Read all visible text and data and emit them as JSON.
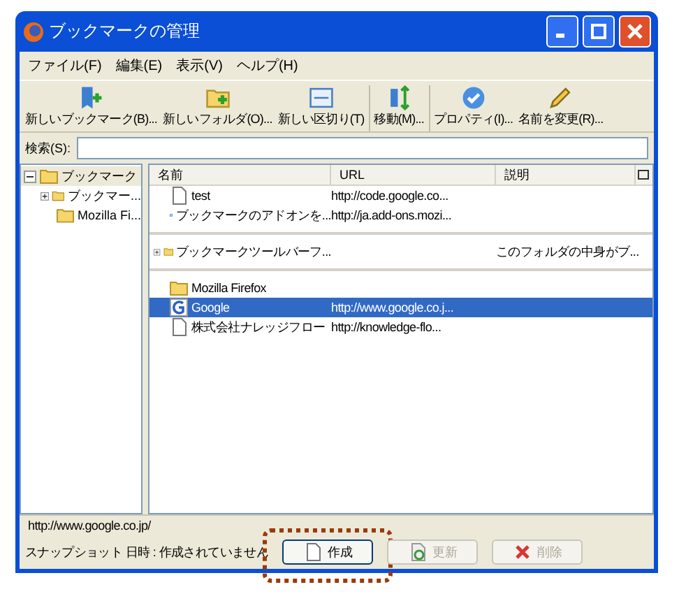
{
  "window": {
    "title": "ブックマークの管理"
  },
  "menu": [
    "ファイル(F)",
    "編集(E)",
    "表示(V)",
    "ヘルプ(H)"
  ],
  "toolbar": [
    "新しいブックマーク(B)...",
    "新しいフォルダ(O)...",
    "新しい区切り(T)",
    "移動(M)...",
    "プロパティ(I)...",
    "名前を変更(R)..."
  ],
  "search": {
    "label": "検索(S):"
  },
  "tree": [
    {
      "label": "ブックマーク",
      "expanded": true,
      "selected": true,
      "children": [
        {
          "label": "ブックマー...",
          "expanded": false,
          "selected": false
        },
        {
          "label": "Mozilla Fi...",
          "selected": false
        }
      ]
    }
  ],
  "columns": [
    "名前",
    "URL",
    "説明"
  ],
  "rows": [
    {
      "kind": "page",
      "name": "test",
      "url": "http://code.google.co...",
      "selected": false
    },
    {
      "kind": "addon",
      "name": "ブックマークのアドオンを...",
      "url": "http://ja.add-ons.mozi...",
      "selected": false
    },
    {
      "kind": "separator"
    },
    {
      "kind": "folder",
      "expanded": false,
      "name": "ブックマークツールバーフ...",
      "description": "このフォルダの中身がブ...",
      "selected": false
    },
    {
      "kind": "separator"
    },
    {
      "kind": "folder",
      "name": "Mozilla Firefox",
      "selected": false
    },
    {
      "kind": "google",
      "name": "Google",
      "url": "http://www.google.co.j...",
      "selected": true
    },
    {
      "kind": "page",
      "name": "株式会社ナレッジフロー",
      "url": "http://knowledge-flo...",
      "selected": false
    }
  ],
  "status_bar": "http://www.google.co.jp/",
  "snapshot": {
    "label": "スナップショット 日時 : 作成されていません",
    "buttons": [
      {
        "label": "作成",
        "disabled": false,
        "highlighted": true
      },
      {
        "label": "更新",
        "disabled": true,
        "highlighted": false
      },
      {
        "label": "削除",
        "disabled": true,
        "highlighted": false
      }
    ]
  }
}
